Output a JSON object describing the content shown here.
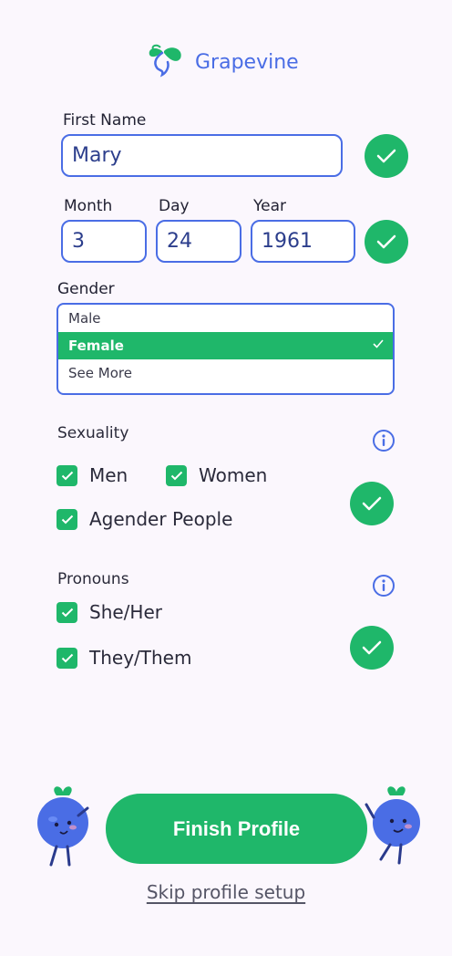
{
  "brand": {
    "name": "Grapevine",
    "accent": "#4a6de5",
    "green": "#1fb76a"
  },
  "first_name": {
    "label": "First Name",
    "value": "Mary"
  },
  "dob": {
    "month_label": "Month",
    "month_value": "3",
    "day_label": "Day",
    "day_value": "24",
    "year_label": "Year",
    "year_value": "1961"
  },
  "gender": {
    "label": "Gender",
    "options": [
      "Male",
      "Female",
      "See More"
    ],
    "selected": "Female"
  },
  "sexuality": {
    "label": "Sexuality",
    "options": [
      {
        "label": "Men",
        "checked": true
      },
      {
        "label": "Women",
        "checked": true
      },
      {
        "label": "Agender People",
        "checked": true
      }
    ]
  },
  "pronouns": {
    "label": "Pronouns",
    "options": [
      {
        "label": "She/Her",
        "checked": true
      },
      {
        "label": "They/Them",
        "checked": true
      }
    ]
  },
  "actions": {
    "finish_label": "Finish Profile",
    "skip_label": "Skip profile setup"
  },
  "icons": [
    "grape-logo-icon",
    "check-icon",
    "info-icon",
    "blueberry-mascot-icon"
  ]
}
